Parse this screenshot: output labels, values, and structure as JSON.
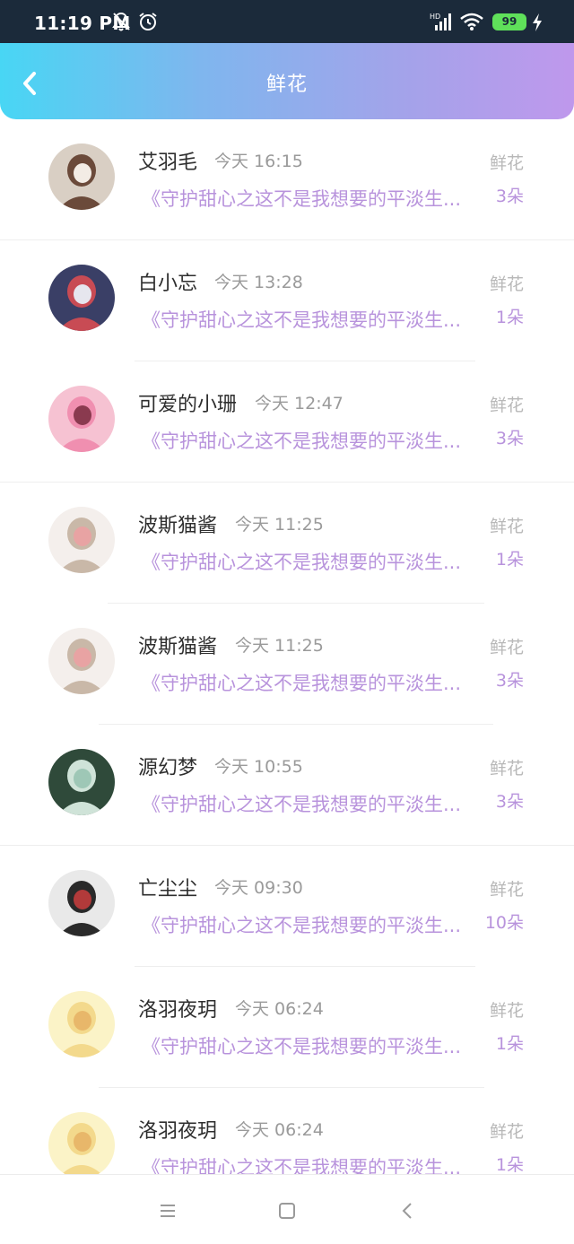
{
  "status_bar": {
    "time": "11:19 PM",
    "battery": "99",
    "icons": [
      "bell-off-icon",
      "alarm-icon",
      "signal-hd-icon",
      "wifi-icon",
      "battery-icon",
      "charging-bolt-icon"
    ]
  },
  "header": {
    "title": "鲜花",
    "back_icon": "chevron-left-icon"
  },
  "items": [
    {
      "name": "艾羽毛",
      "time": "今天 16:15",
      "book": "《守护甜心之这不是我想要的平淡生...",
      "gift_type": "鲜花",
      "gift_count": "3朵",
      "avatar_colors": [
        "#d9cfc4",
        "#6b4a3a",
        "#f3ece5"
      ]
    },
    {
      "name": "白小忘",
      "time": "今天 13:28",
      "book": "《守护甜心之这不是我想要的平淡生...",
      "gift_type": "鲜花",
      "gift_count": "1朵",
      "avatar_colors": [
        "#3a3f66",
        "#c84b54",
        "#e6e6ee"
      ]
    },
    {
      "name": "可爱的小珊",
      "time": "今天 12:47",
      "book": "《守护甜心之这不是我想要的平淡生...",
      "gift_type": "鲜花",
      "gift_count": "3朵",
      "avatar_colors": [
        "#f6c2d2",
        "#f08fb0",
        "#8a3a4f"
      ]
    },
    {
      "name": "波斯猫酱",
      "time": "今天 11:25",
      "book": "《守护甜心之这不是我想要的平淡生...",
      "gift_type": "鲜花",
      "gift_count": "1朵",
      "avatar_colors": [
        "#f4efec",
        "#c9b8a8",
        "#e8a3a3"
      ]
    },
    {
      "name": "波斯猫酱",
      "time": "今天 11:25",
      "book": "《守护甜心之这不是我想要的平淡生...",
      "gift_type": "鲜花",
      "gift_count": "3朵",
      "avatar_colors": [
        "#f4efec",
        "#c9b8a8",
        "#e8a3a3"
      ]
    },
    {
      "name": "源幻梦",
      "time": "今天 10:55",
      "book": "《守护甜心之这不是我想要的平淡生...",
      "gift_type": "鲜花",
      "gift_count": "3朵",
      "avatar_colors": [
        "#2f4a3a",
        "#cfe3d8",
        "#9ec7b6"
      ]
    },
    {
      "name": "亡尘尘",
      "time": "今天 09:30",
      "book": "《守护甜心之这不是我想要的平淡生...",
      "gift_type": "鲜花",
      "gift_count": "10朵",
      "avatar_colors": [
        "#e9e9e9",
        "#2a2a2a",
        "#b23a3a"
      ]
    },
    {
      "name": "洛羽夜玥",
      "time": "今天 06:24",
      "book": "《守护甜心之这不是我想要的平淡生...",
      "gift_type": "鲜花",
      "gift_count": "1朵",
      "avatar_colors": [
        "#fbf3c7",
        "#f3d98c",
        "#e8b76a"
      ]
    },
    {
      "name": "洛羽夜玥",
      "time": "今天 06:24",
      "book": "《守护甜心之这不是我想要的平淡生...",
      "gift_type": "鲜花",
      "gift_count": "1朵",
      "avatar_colors": [
        "#fbf3c7",
        "#f3d98c",
        "#e8b76a"
      ]
    }
  ],
  "nav_bar": {
    "icons": [
      "menu-icon",
      "home-square-icon",
      "back-triangle-icon"
    ]
  }
}
